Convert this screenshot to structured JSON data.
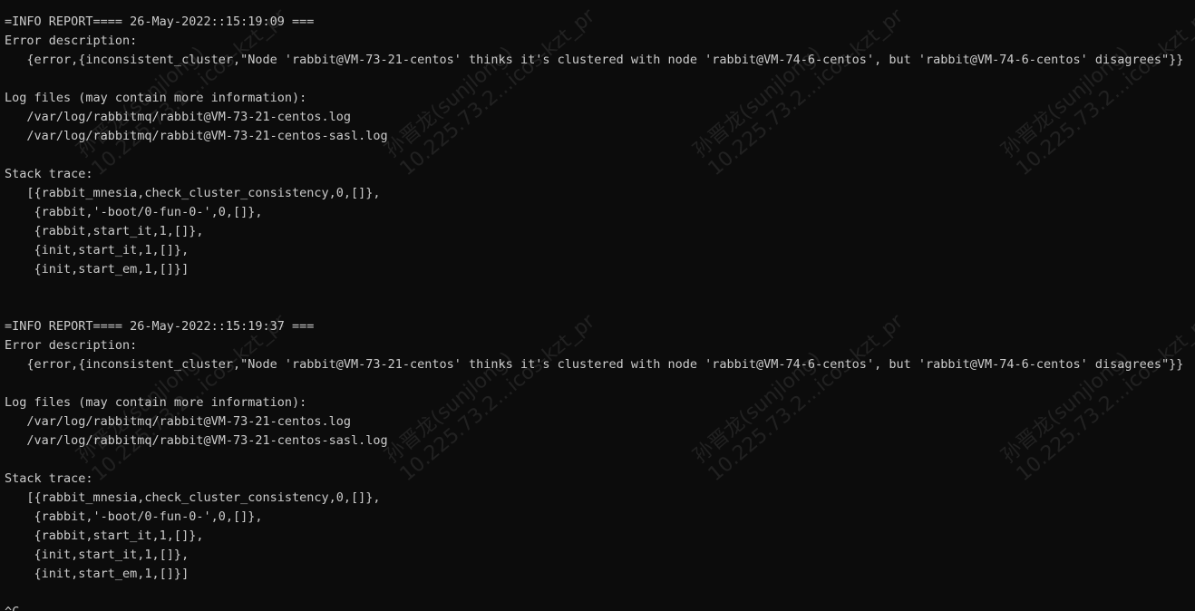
{
  "terminal": {
    "lines": [
      "=INFO REPORT==== 26-May-2022::15:19:09 ===",
      "Error description:",
      "   {error,{inconsistent_cluster,\"Node 'rabbit@VM-73-21-centos' thinks it's clustered with node 'rabbit@VM-74-6-centos', but 'rabbit@VM-74-6-centos' disagrees\"}}",
      "",
      "Log files (may contain more information):",
      "   /var/log/rabbitmq/rabbit@VM-73-21-centos.log",
      "   /var/log/rabbitmq/rabbit@VM-73-21-centos-sasl.log",
      "",
      "Stack trace:",
      "   [{rabbit_mnesia,check_cluster_consistency,0,[]},",
      "    {rabbit,'-boot/0-fun-0-',0,[]},",
      "    {rabbit,start_it,1,[]},",
      "    {init,start_it,1,[]},",
      "    {init,start_em,1,[]}]",
      "",
      "",
      "=INFO REPORT==== 26-May-2022::15:19:37 ===",
      "Error description:",
      "   {error,{inconsistent_cluster,\"Node 'rabbit@VM-73-21-centos' thinks it's clustered with node 'rabbit@VM-74-6-centos', but 'rabbit@VM-74-6-centos' disagrees\"}}",
      "",
      "Log files (may contain more information):",
      "   /var/log/rabbitmq/rabbit@VM-73-21-centos.log",
      "   /var/log/rabbitmq/rabbit@VM-73-21-centos-sasl.log",
      "",
      "Stack trace:",
      "   [{rabbit_mnesia,check_cluster_consistency,0,[]},",
      "    {rabbit,'-boot/0-fun-0-',0,[]},",
      "    {rabbit,start_it,1,[]},",
      "    {init,start_it,1,[]},",
      "    {init,start_em,1,[]}]",
      "",
      "^C"
    ]
  },
  "watermark": {
    "name_line": "孙晋龙(sunjlong)",
    "ip_line": "10.225.73.2...icos-kzt_pr"
  },
  "colors": {
    "background": "#0c0c0c",
    "text": "#cccccc"
  }
}
